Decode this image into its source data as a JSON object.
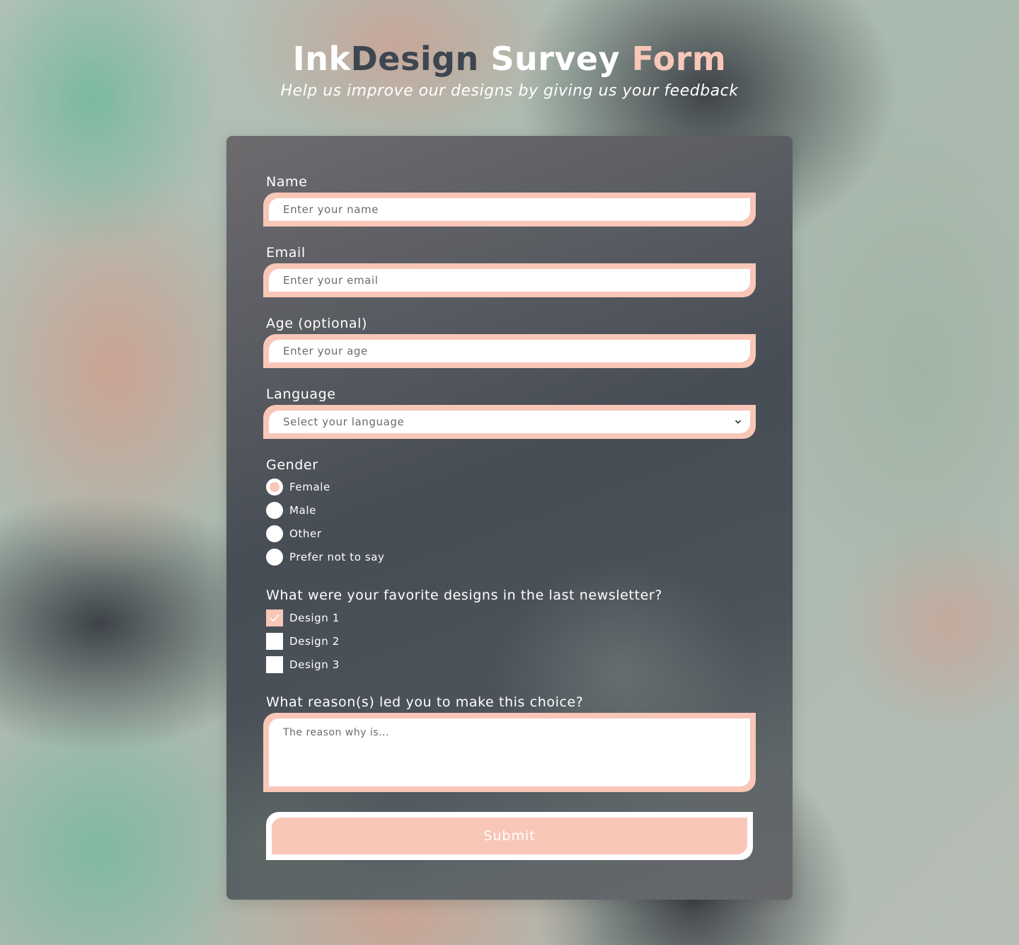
{
  "header": {
    "title_parts": [
      "Ink",
      "Design",
      " Survey",
      " Form"
    ],
    "subtitle": "Help us improve our designs by giving us your feedback"
  },
  "colors": {
    "accent": "#f8c7b8",
    "title_dark": "#3d4650",
    "text": "#ffffff"
  },
  "form": {
    "name": {
      "label": "Name",
      "placeholder": "Enter your name"
    },
    "email": {
      "label": "Email",
      "placeholder": "Enter your email"
    },
    "age": {
      "label": "Age (optional)",
      "placeholder": "Enter your age"
    },
    "language": {
      "label": "Language",
      "selected": "Select your language",
      "icon": "chevron-down-icon"
    },
    "gender": {
      "label": "Gender",
      "options": [
        {
          "label": "Female",
          "checked": true
        },
        {
          "label": "Male",
          "checked": false
        },
        {
          "label": "Other",
          "checked": false
        },
        {
          "label": "Prefer not to say",
          "checked": false
        }
      ]
    },
    "favorites": {
      "label": "What were your favorite designs in the last newsletter?",
      "options": [
        {
          "label": "Design 1",
          "checked": true
        },
        {
          "label": "Design 2",
          "checked": false
        },
        {
          "label": "Design 3",
          "checked": false
        }
      ]
    },
    "reason": {
      "label": "What reason(s) led you to make this choice?",
      "placeholder": "The reason why is..."
    },
    "submit_label": "Submit"
  }
}
